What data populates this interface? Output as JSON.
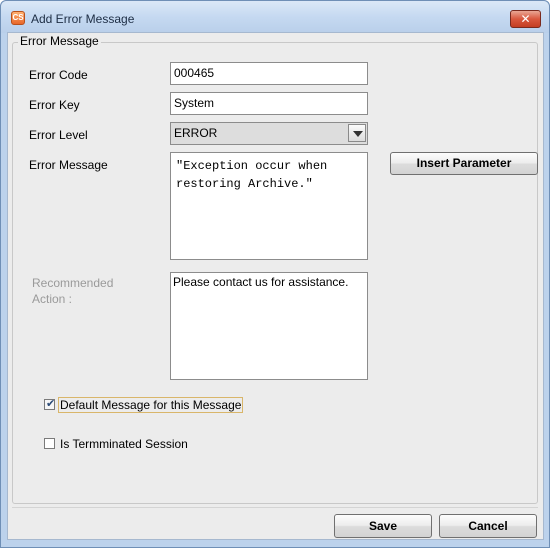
{
  "window": {
    "title": "Add Error Message",
    "app_icon_text": "CS",
    "close_symbol": "✕"
  },
  "group": {
    "legend": "Error Message"
  },
  "fields": {
    "error_code": {
      "label": "Error Code",
      "value": "000465"
    },
    "error_key": {
      "label": "Error Key",
      "value": "System"
    },
    "error_level": {
      "label": "Error Level",
      "value": "ERROR"
    },
    "error_message": {
      "label": "Error Message",
      "value": "\"Exception occur when restoring Archive.\""
    },
    "recommended_action": {
      "label": "Recommended Action :",
      "value": "Please contact us for assistance."
    }
  },
  "buttons": {
    "insert_parameter": "Insert Parameter",
    "save": "Save",
    "cancel": "Cancel"
  },
  "checkboxes": {
    "default_message": {
      "label": "Default Message for this Message",
      "checked": true
    },
    "terminated_session": {
      "label": "Is Termminated Session",
      "checked": false
    }
  },
  "icons": {
    "app": "app-logo-icon",
    "close": "close-icon",
    "dropdown": "chevron-down-icon",
    "check": "checkmark-icon"
  },
  "colors": {
    "title_bar": "#c5d9f1",
    "close_button": "#d9583e",
    "dialog_bg": "#ececec",
    "disabled_label": "#9a9a9a"
  }
}
